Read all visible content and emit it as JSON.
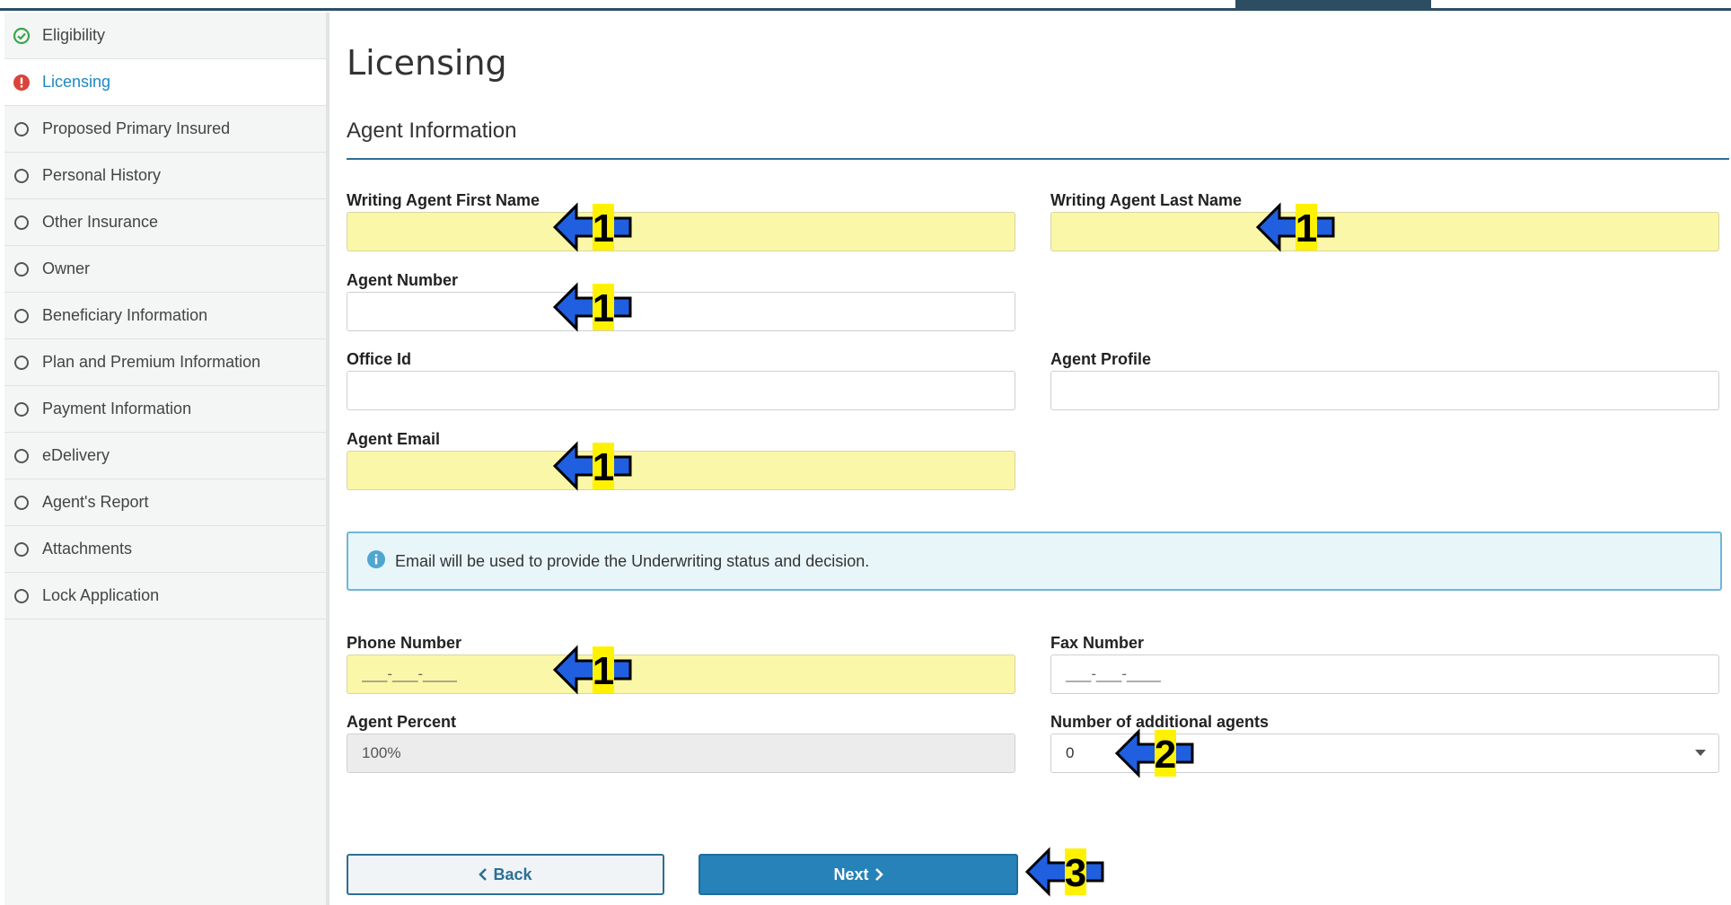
{
  "nav": [
    {
      "label": "Eligibility",
      "status": "complete"
    },
    {
      "label": "Licensing",
      "status": "error"
    },
    {
      "label": "Proposed Primary Insured",
      "status": "pending"
    },
    {
      "label": "Personal History",
      "status": "pending"
    },
    {
      "label": "Other Insurance",
      "status": "pending"
    },
    {
      "label": "Owner",
      "status": "pending"
    },
    {
      "label": "Beneficiary Information",
      "status": "pending"
    },
    {
      "label": "Plan and Premium Information",
      "status": "pending"
    },
    {
      "label": "Payment Information",
      "status": "pending"
    },
    {
      "label": "eDelivery",
      "status": "pending"
    },
    {
      "label": "Agent's Report",
      "status": "pending"
    },
    {
      "label": "Attachments",
      "status": "pending"
    },
    {
      "label": "Lock Application",
      "status": "pending"
    }
  ],
  "page": {
    "title": "Licensing",
    "section": "Agent Information"
  },
  "form": {
    "first_name": {
      "label": "Writing Agent First Name",
      "value": ""
    },
    "last_name": {
      "label": "Writing Agent Last Name",
      "value": ""
    },
    "agent_number": {
      "label": "Agent Number",
      "value": ""
    },
    "office_id": {
      "label": "Office Id",
      "value": ""
    },
    "agent_profile": {
      "label": "Agent Profile",
      "value": ""
    },
    "agent_email": {
      "label": "Agent Email",
      "value": ""
    },
    "phone": {
      "label": "Phone Number",
      "placeholder": "___-___-____"
    },
    "fax": {
      "label": "Fax Number",
      "placeholder": "___-___-____"
    },
    "agent_percent": {
      "label": "Agent Percent",
      "value": "100%"
    },
    "additional_agents": {
      "label": "Number of additional agents",
      "value": "0"
    }
  },
  "info": {
    "text": "Email will be used to provide the Underwriting status and decision."
  },
  "buttons": {
    "back": "Back",
    "next": "Next"
  },
  "markers": {
    "one": "1",
    "two": "2",
    "three": "3"
  },
  "colors": {
    "complete": "#3aa64a",
    "error": "#d9443b",
    "accent": "#2682b8",
    "required": "#fbf7a8",
    "marker_arrow": "#1f5fe0",
    "marker_label": "#fff200"
  }
}
